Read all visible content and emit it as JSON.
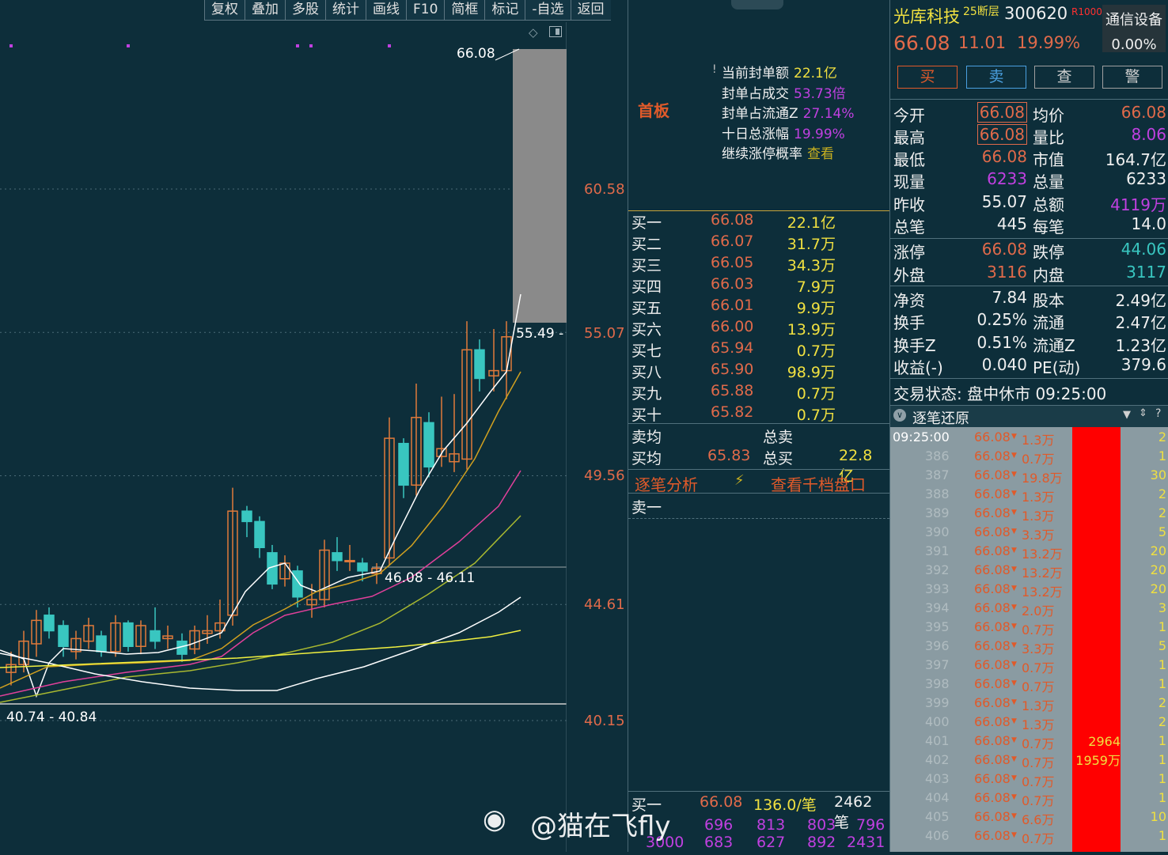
{
  "toolbar": {
    "items": [
      "复权",
      "叠加",
      "多股",
      "统计",
      "画线",
      "F10",
      "简框",
      "标记",
      "-自选",
      "返回"
    ]
  },
  "chart": {
    "price_labels": [
      "60.58",
      "55.07",
      "49.56",
      "44.61",
      "40.15"
    ],
    "high_label": "66.08",
    "annot_1": "55.49 -",
    "annot_2": "46.08 - 46.11",
    "annot_3": "40.74 - 40.84",
    "colors": {
      "up": "#e07a3a",
      "down": "#39c6c0",
      "ma5": "#ffffff",
      "ma10": "#d0a020",
      "ma20": "#e0409a",
      "ma30": "#a8b830",
      "ma60": "#ffffff",
      "ma120": "#f0f040"
    }
  },
  "seal": {
    "label": "首板",
    "rows": [
      {
        "k": "当前封单额",
        "v": "22.1亿"
      },
      {
        "k": "封单占成交",
        "v": "53.73倍"
      },
      {
        "k": "封单占流通Z",
        "v": "27.14%"
      },
      {
        "k": "十日总涨幅",
        "v": "19.99%"
      },
      {
        "k": "继续涨停概率",
        "v": "查看"
      }
    ]
  },
  "orderbook": {
    "bids": [
      {
        "l": "买一",
        "p": "66.08",
        "v": "22.1亿"
      },
      {
        "l": "买二",
        "p": "66.07",
        "v": "31.7万"
      },
      {
        "l": "买三",
        "p": "66.05",
        "v": "34.3万"
      },
      {
        "l": "买四",
        "p": "66.03",
        "v": "7.9万"
      },
      {
        "l": "买五",
        "p": "66.01",
        "v": "9.9万"
      },
      {
        "l": "买六",
        "p": "66.00",
        "v": "13.9万"
      },
      {
        "l": "买七",
        "p": "65.94",
        "v": "0.7万"
      },
      {
        "l": "买八",
        "p": "65.90",
        "v": "98.9万"
      },
      {
        "l": "买九",
        "p": "65.88",
        "v": "0.7万"
      },
      {
        "l": "买十",
        "p": "65.82",
        "v": "0.7万"
      }
    ],
    "sell_avg_label": "卖均",
    "total_sell_label": "总卖",
    "buy_avg_label": "买均",
    "buy_avg": "65.83",
    "total_buy_label": "总买",
    "total_buy": "22.8亿",
    "analysis": "逐笔分析",
    "thousand": "查看千档盘口",
    "ask1": "卖一",
    "bottom_l": "买一",
    "bottom_p": "66.08",
    "bottom_per": "136.0/笔",
    "bottom_cnt": "2462笔",
    "queue_1": [
      "696",
      "813",
      "803",
      "796"
    ],
    "queue_2": [
      "3000",
      "683",
      "627",
      "892",
      "2431"
    ]
  },
  "quote": {
    "name": "光库科技",
    "tier": "25断层",
    "code": "300620",
    "flag": "R1000",
    "industry": "通信设备",
    "price": "66.08",
    "change": "11.01",
    "pct": "19.99%",
    "pct2": "0.00%",
    "buttons": [
      "买",
      "卖",
      "查",
      "警"
    ],
    "fields": [
      {
        "k1": "今开",
        "v1": "66.08",
        "k2": "均价",
        "v2": "66.08"
      },
      {
        "k1": "最高",
        "v1": "66.08",
        "k2": "量比",
        "v2": "8.06"
      },
      {
        "k1": "最低",
        "v1": "66.08",
        "k2": "市值",
        "v2": "164.7亿"
      },
      {
        "k1": "现量",
        "v1": "6233",
        "k2": "总量",
        "v2": "6233"
      },
      {
        "k1": "昨收",
        "v1": "55.07",
        "k2": "总额",
        "v2": "4119万"
      },
      {
        "k1": "总笔",
        "v1": "445",
        "k2": "每笔",
        "v2": "14.0"
      },
      {
        "k1": "涨停",
        "v1": "66.08",
        "k2": "跌停",
        "v2": "44.06"
      },
      {
        "k1": "外盘",
        "v1": "3116",
        "k2": "内盘",
        "v2": "3117"
      },
      {
        "k1": "净资",
        "v1": "7.84",
        "k2": "股本",
        "v2": "2.49亿"
      },
      {
        "k1": "换手",
        "v1": "0.25%",
        "k2": "流通",
        "v2": "2.47亿"
      },
      {
        "k1": "换手Z",
        "v1": "0.51%",
        "k2": "流通Z",
        "v2": "1.23亿"
      },
      {
        "k1": "收益(-)",
        "v1": "0.040",
        "k2": "PE(动)",
        "v2": "379.6"
      }
    ],
    "status": "交易状态: 盘中休市 09:25:00",
    "tick_title": "逐笔还原"
  },
  "ticks": [
    {
      "t": "09:25:00",
      "p": "66.08",
      "v": "1.3万",
      "n": "2"
    },
    {
      "t": "386",
      "p": "66.08",
      "v": "0.7万",
      "n": "1"
    },
    {
      "t": "387",
      "p": "66.08",
      "v": "19.8万",
      "n": "30"
    },
    {
      "t": "388",
      "p": "66.08",
      "v": "1.3万",
      "n": "2"
    },
    {
      "t": "389",
      "p": "66.08",
      "v": "1.3万",
      "n": "2"
    },
    {
      "t": "390",
      "p": "66.08",
      "v": "3.3万",
      "n": "5"
    },
    {
      "t": "391",
      "p": "66.08",
      "v": "13.2万",
      "n": "20"
    },
    {
      "t": "392",
      "p": "66.08",
      "v": "13.2万",
      "n": "20"
    },
    {
      "t": "393",
      "p": "66.08",
      "v": "13.2万",
      "n": "20"
    },
    {
      "t": "394",
      "p": "66.08",
      "v": "2.0万",
      "n": "3"
    },
    {
      "t": "395",
      "p": "66.08",
      "v": "0.7万",
      "n": "1"
    },
    {
      "t": "396",
      "p": "66.08",
      "v": "3.3万",
      "n": "5"
    },
    {
      "t": "397",
      "p": "66.08",
      "v": "0.7万",
      "n": "1"
    },
    {
      "t": "398",
      "p": "66.08",
      "v": "0.7万",
      "n": "1"
    },
    {
      "t": "399",
      "p": "66.08",
      "v": "1.3万",
      "n": "2"
    },
    {
      "t": "400",
      "p": "66.08",
      "v": "1.3万",
      "n": "2"
    },
    {
      "t": "401",
      "p": "66.08",
      "v": "0.7万",
      "n": "1"
    },
    {
      "t": "402",
      "p": "66.08",
      "v": "0.7万",
      "n": "1"
    },
    {
      "t": "403",
      "p": "66.08",
      "v": "0.7万",
      "n": "1"
    },
    {
      "t": "404",
      "p": "66.08",
      "v": "0.7万",
      "n": "1"
    },
    {
      "t": "405",
      "p": "66.08",
      "v": "6.6万",
      "n": "10"
    },
    {
      "t": "406",
      "p": "66.08",
      "v": "0.7万",
      "n": "1"
    }
  ],
  "red_bar": {
    "count": "2964",
    "amount": "1959万"
  },
  "watermark": "@猫在飞fly"
}
